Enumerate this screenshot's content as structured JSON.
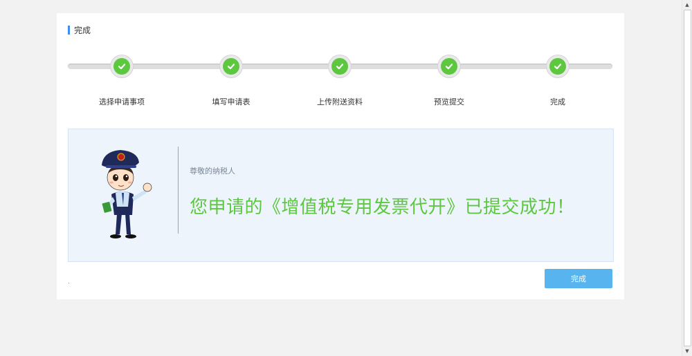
{
  "section": {
    "title": "完成"
  },
  "steps": [
    {
      "label": "选择申请事项",
      "status": "done"
    },
    {
      "label": "填写申请表",
      "status": "done"
    },
    {
      "label": "上传附送资料",
      "status": "done"
    },
    {
      "label": "预览提交",
      "status": "done"
    },
    {
      "label": "完成",
      "status": "done"
    }
  ],
  "result": {
    "greeting": "尊敬的纳税人",
    "message": "您申请的《增值税专用发票代开》已提交成功！",
    "mascot": "tax-officer-mascot"
  },
  "actions": {
    "finish_label": "完成"
  },
  "colors": {
    "accent": "#3e8ef7",
    "success": "#5cc73f",
    "button": "#57b4ef",
    "box_bg": "#edf4fc"
  },
  "icons": {
    "step_done": "check-icon"
  }
}
